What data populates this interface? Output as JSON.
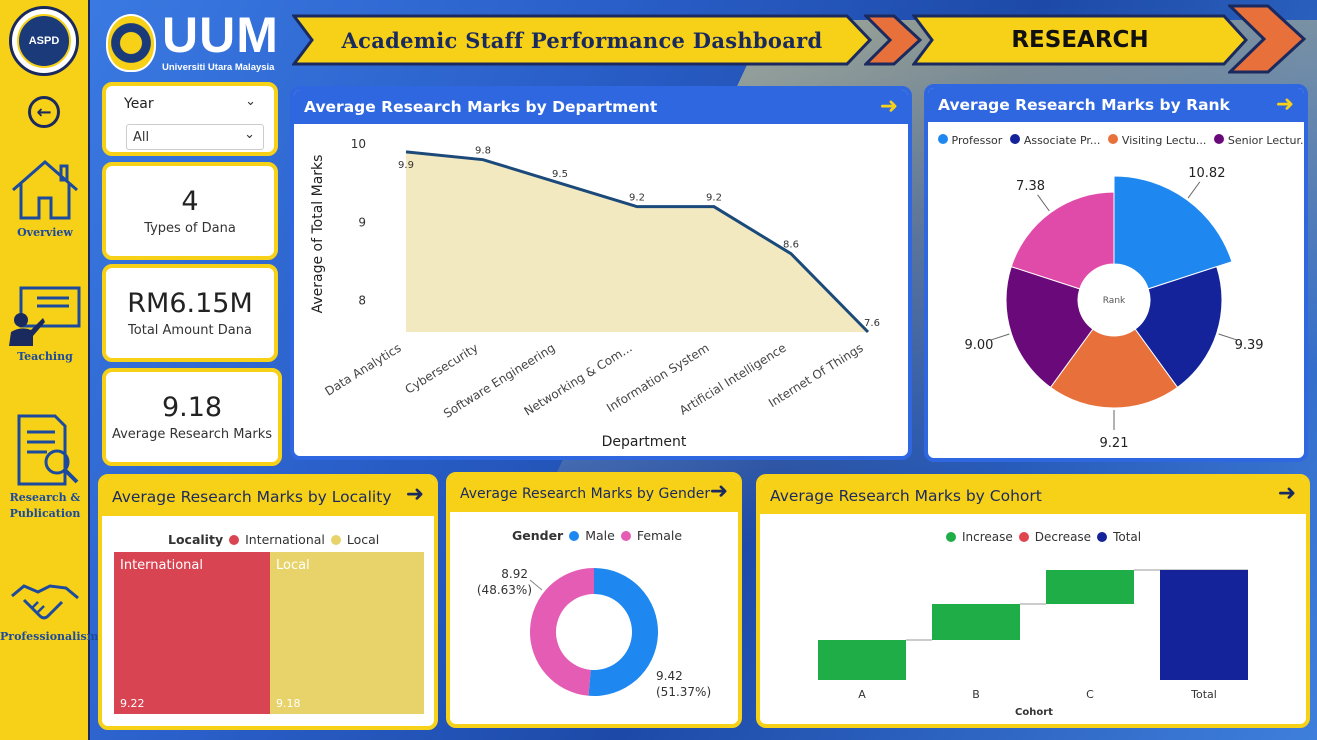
{
  "app": {
    "logo_text": "UUM",
    "logo_subtitle": "Universiti Utara Malaysia",
    "badge": "ASPD"
  },
  "header": {
    "title": "Academic Staff Performance Dashboard",
    "section": "RESEARCH"
  },
  "sidebar": {
    "back_icon": "arrow-left-circle-icon",
    "items": [
      {
        "label": "Overview",
        "icon": "house-icon"
      },
      {
        "label": "Teaching",
        "icon": "teacher-board-icon"
      },
      {
        "label": "Research &",
        "label2": "Publication",
        "icon": "document-magnifier-icon"
      },
      {
        "label": "Professionalism",
        "icon": "handshake-icon"
      }
    ]
  },
  "filter": {
    "label": "Year",
    "value": "All"
  },
  "kpis": [
    {
      "value": "4",
      "caption": "Types of Dana"
    },
    {
      "value": "RM6.15M",
      "caption": "Total Amount Dana"
    },
    {
      "value": "9.18",
      "caption": "Average Research Marks"
    }
  ],
  "colors": {
    "yellow": "#f7d117",
    "navy": "#1b2a5e",
    "blue": "#2f67e0",
    "line": "#1b4a7a",
    "area": "#f3e9c0",
    "professor": "#1e88f0",
    "associate": "#15239a",
    "visiting": "#e8703a",
    "senior": "#6a0a7a",
    "pink": "#e04aa8",
    "international": "#d94452",
    "local": "#e8d26a",
    "male": "#1e88f0",
    "female": "#e45cb4",
    "increase": "#1fad47",
    "decrease": "#e0454f",
    "total": "#15239a"
  },
  "charts": {
    "department": {
      "title": "Average Research Marks by Department",
      "chart_data": {
        "type": "area",
        "categories": [
          "Data Analytics",
          "Cybersecurity",
          "Software Engineering",
          "Networking & Com...",
          "Information System",
          "Artificial Intelligence",
          "Internet Of Things"
        ],
        "values": [
          9.9,
          9.8,
          9.5,
          9.2,
          9.2,
          8.6,
          7.6
        ],
        "xlabel": "Department",
        "ylabel": "Average of Total Marks",
        "yticks": [
          "10",
          "9",
          "8"
        ],
        "ylim": [
          7.6,
          10
        ]
      }
    },
    "rank": {
      "title": "Average Research Marks by Rank",
      "center_label": "Rank",
      "legend": [
        "Professor",
        "Associate Pr...",
        "Visiting Lectu...",
        "Senior Lectur..."
      ],
      "chart_data": {
        "type": "pie",
        "labels": [
          "Professor",
          "Associate Professor",
          "Visiting Lecturer",
          "Senior Lecturer",
          ""
        ],
        "values": [
          10.82,
          9.39,
          9.21,
          9.0,
          7.38
        ],
        "value_labels": [
          "10.82",
          "9.39",
          "9.21",
          "9.00",
          "7.38"
        ]
      }
    },
    "locality": {
      "title": "Average Research Marks by Locality",
      "legend_title": "Locality",
      "chart_data": {
        "type": "treemap",
        "labels": [
          "International",
          "Local"
        ],
        "values": [
          9.22,
          9.18
        ],
        "value_labels": [
          "9.22",
          "9.18"
        ]
      }
    },
    "gender": {
      "title": "Average Research Marks by Gender",
      "legend_title": "Gender",
      "chart_data": {
        "type": "donut",
        "labels": [
          "Male",
          "Female"
        ],
        "values": [
          9.42,
          8.92
        ],
        "value_labels": [
          "9.42",
          "8.92"
        ],
        "percent_labels": [
          "(51.37%)",
          "(48.63%)"
        ]
      }
    },
    "cohort": {
      "title": "Average Research Marks by Cohort",
      "legend": [
        "Increase",
        "Decrease",
        "Total"
      ],
      "chart_data": {
        "type": "waterfall",
        "categories": [
          "A",
          "B",
          "C",
          "Total"
        ],
        "xlabel": "Cohort",
        "bar_types": [
          "increase",
          "increase",
          "increase",
          "total"
        ]
      }
    }
  }
}
